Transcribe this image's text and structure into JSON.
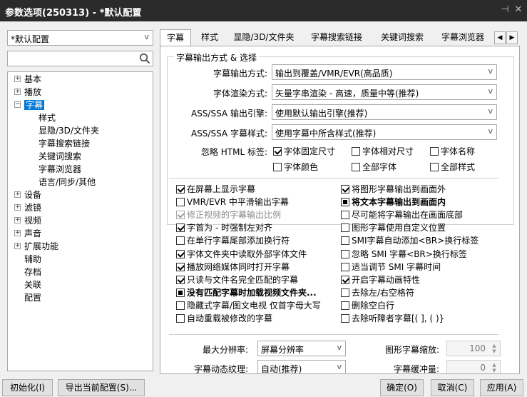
{
  "window": {
    "title": "参数选项(250313) - *默认配置",
    "pin_glyph": "⊣",
    "close_glyph": "✕"
  },
  "sidebar": {
    "profile_value": "*默认配置",
    "search_value": "",
    "tree": [
      {
        "label": "基本",
        "expand": "+"
      },
      {
        "label": "播放",
        "expand": "+"
      },
      {
        "label": "字幕",
        "expand": "−",
        "selected": true
      },
      {
        "label": "样式"
      },
      {
        "label": "显隐/3D/文件夹"
      },
      {
        "label": "字幕搜索链接"
      },
      {
        "label": "关键词搜索"
      },
      {
        "label": "字幕浏览器"
      },
      {
        "label": "语言/同步/其他"
      },
      {
        "label": "设备",
        "expand": "+"
      },
      {
        "label": "滤镜",
        "expand": "+"
      },
      {
        "label": "视频",
        "expand": "+"
      },
      {
        "label": "声音",
        "expand": "+"
      },
      {
        "label": "扩展功能",
        "expand": "+"
      },
      {
        "label": "辅助"
      },
      {
        "label": "存档"
      },
      {
        "label": "关联"
      },
      {
        "label": "配置"
      }
    ]
  },
  "tabs": [
    {
      "label": "字幕",
      "active": true
    },
    {
      "label": "样式"
    },
    {
      "label": "显隐/3D/文件夹"
    },
    {
      "label": "字幕搜索链接"
    },
    {
      "label": "关键词搜索"
    },
    {
      "label": "字幕浏览器"
    }
  ],
  "tab_scroll": {
    "left": "◀",
    "right": "▶"
  },
  "group": {
    "legend": "字幕输出方式 & 选择",
    "fields": [
      {
        "label": "字幕输出方式:",
        "value": "输出到覆盖/VMR/EVR(高品质)"
      },
      {
        "label": "字体渲染方式:",
        "value": "矢量字串渲染 - 高速，质量中等(推荐)"
      },
      {
        "label": "ASS/SSA 输出引擎:",
        "value": "使用默认输出引擎(推荐)"
      },
      {
        "label": "ASS/SSA 字幕样式:",
        "value": "使用字幕中所含样式(推荐)"
      }
    ],
    "ignore_label": "忽略 HTML 标签:",
    "ignore_options": [
      {
        "label": "字体固定尺寸",
        "state": "checked"
      },
      {
        "label": "字体相对尺寸",
        "state": ""
      },
      {
        "label": "字体名称",
        "state": ""
      },
      {
        "label": "字体颜色",
        "state": ""
      },
      {
        "label": "全部字体",
        "state": ""
      },
      {
        "label": "全部样式",
        "state": ""
      }
    ]
  },
  "options_left": [
    {
      "label": "在屏幕上显示字幕",
      "state": "checked"
    },
    {
      "label": "VMR/EVR 中平滑输出字幕",
      "state": ""
    },
    {
      "label": "修正视频的字幕输出比例",
      "state": "checked",
      "disabled": true
    },
    {
      "label": "字首为 - 时强制左对齐",
      "state": "checked"
    },
    {
      "label": "在单行字幕尾部添加换行符",
      "state": ""
    },
    {
      "label": "字体文件夹中读取外部字体文件",
      "state": "checked"
    },
    {
      "label": "播放网络媒体同时打开字幕",
      "state": "checked"
    },
    {
      "label": "只读与文件名完全匹配的字幕",
      "state": "checked"
    },
    {
      "label": "没有匹配字幕时加载视频文件夹...",
      "state": "ind",
      "bold": true
    },
    {
      "label": "隐藏式字幕/图文电视 仅首字母大写",
      "state": ""
    },
    {
      "label": "自动重载被修改的字幕",
      "state": ""
    }
  ],
  "options_right": [
    {
      "label": "将图形字幕输出到画面外",
      "state": "checked"
    },
    {
      "label": "将文本字幕输出到画面内",
      "state": "ind",
      "bold": true
    },
    {
      "label": "尽可能将字幕输出在画面底部",
      "state": ""
    },
    {
      "label": "图形字幕使用自定义位置",
      "state": ""
    },
    {
      "label": "SMI字幕自动添加<BR>换行标签",
      "state": ""
    },
    {
      "label": "忽略 SMI 字幕<BR>换行标签",
      "state": ""
    },
    {
      "label": "适当调节 SMI 字幕时间",
      "state": ""
    },
    {
      "label": "开启字幕动画特性",
      "state": "checked"
    },
    {
      "label": "去除左/右空格符",
      "state": ""
    },
    {
      "label": "删除空白行",
      "state": ""
    },
    {
      "label": "去除听障者字幕[( ], ( )}",
      "state": ""
    }
  ],
  "bottom_fields": {
    "max_res_label": "最大分辨率:",
    "max_res_value": "屏幕分辨率",
    "scale_label": "图形字幕缩放:",
    "scale_value": "100",
    "texture_label": "字幕动态纹理:",
    "texture_value": "自动(推荐)",
    "buffer_label": "字幕缓冲量:",
    "buffer_value": "0"
  },
  "footer": {
    "init_label": "初始化(I)",
    "export_label": "导出当前配置(S)...",
    "ok_label": "确定(O)",
    "cancel_label": "取消(C)",
    "apply_label": "应用(A)"
  }
}
